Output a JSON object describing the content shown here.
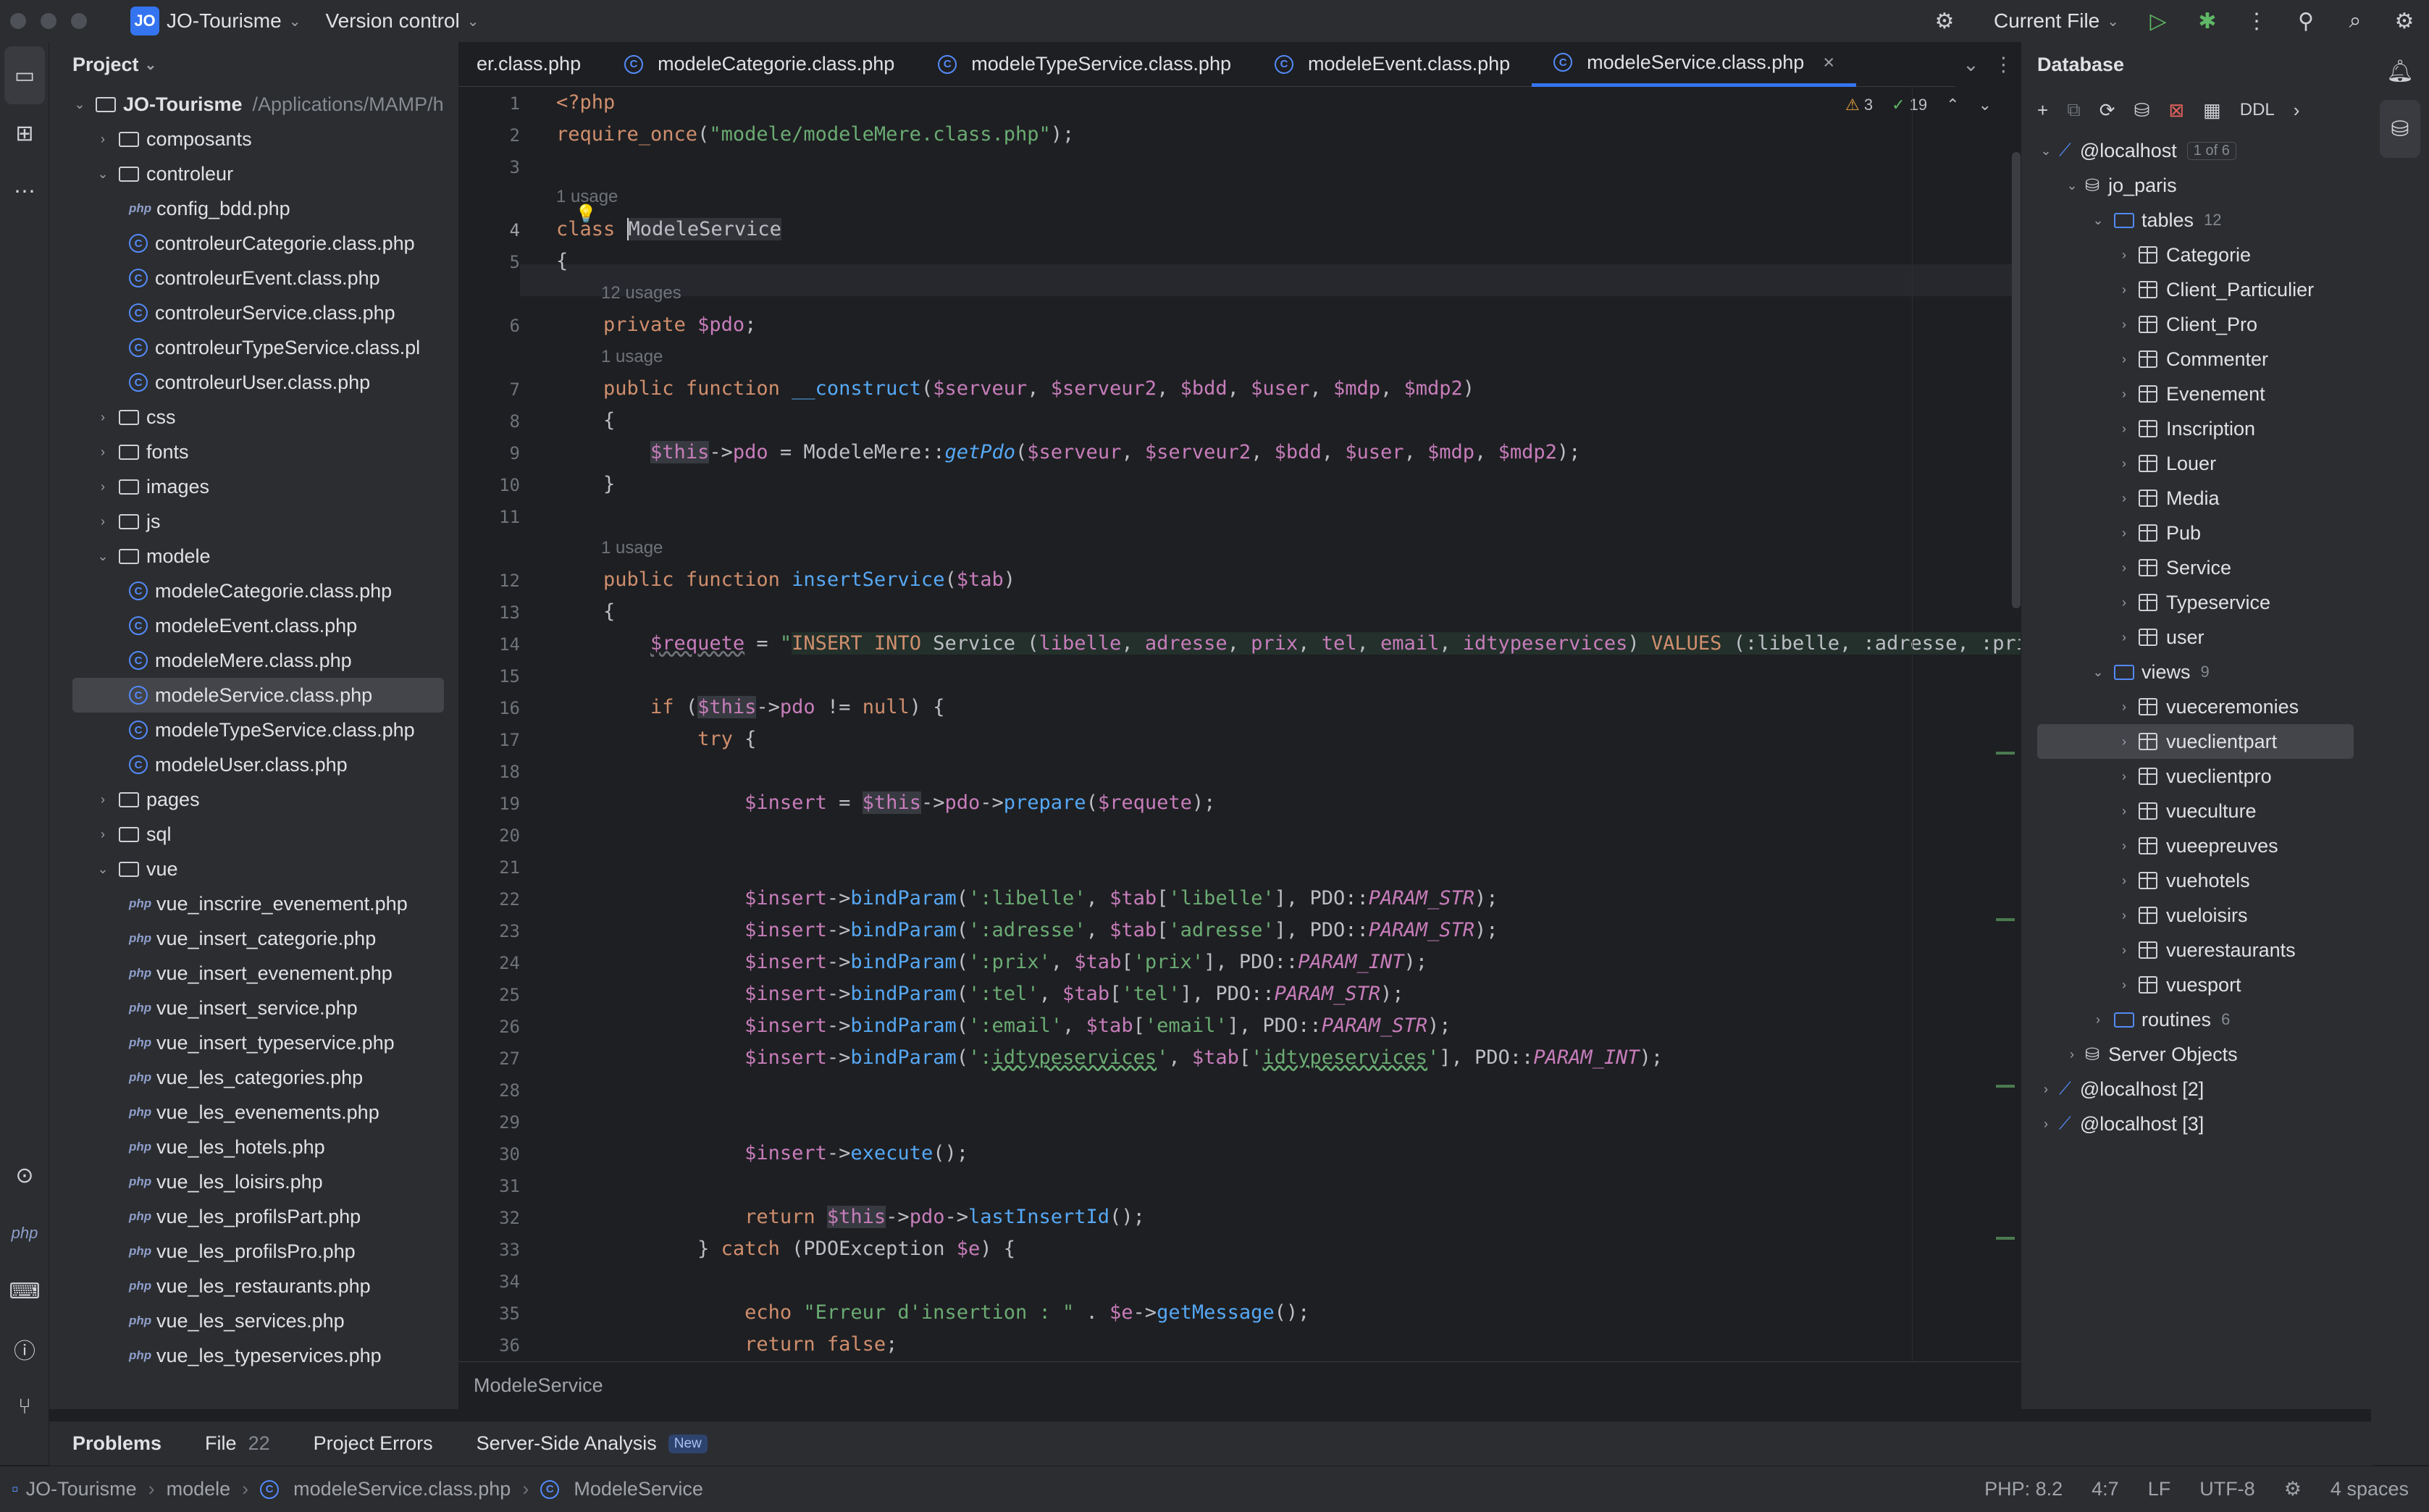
{
  "titlebar": {
    "project_badge": "JO",
    "project_name": "JO-Tourisme",
    "vcs": "Version control",
    "run_config": "Current File"
  },
  "project_panel": {
    "title": "Project",
    "root": {
      "name": "JO-Tourisme",
      "path": "/Applications/MAMP/h"
    },
    "rows": [
      {
        "type": "folder",
        "name": "composants",
        "level": 1,
        "expanded": false
      },
      {
        "type": "folder",
        "name": "controleur",
        "level": 1,
        "expanded": true
      },
      {
        "type": "php",
        "name": "config_bdd.php",
        "level": 2
      },
      {
        "type": "class",
        "name": "controleurCategorie.class.php",
        "level": 2
      },
      {
        "type": "class",
        "name": "controleurEvent.class.php",
        "level": 2
      },
      {
        "type": "class",
        "name": "controleurService.class.php",
        "level": 2
      },
      {
        "type": "class",
        "name": "controleurTypeService.class.pl",
        "level": 2
      },
      {
        "type": "class",
        "name": "controleurUser.class.php",
        "level": 2
      },
      {
        "type": "folder",
        "name": "css",
        "level": 1,
        "expanded": false
      },
      {
        "type": "folder",
        "name": "fonts",
        "level": 1,
        "expanded": false
      },
      {
        "type": "folder",
        "name": "images",
        "level": 1,
        "expanded": false
      },
      {
        "type": "folder",
        "name": "js",
        "level": 1,
        "expanded": false
      },
      {
        "type": "folder",
        "name": "modele",
        "level": 1,
        "expanded": true
      },
      {
        "type": "class",
        "name": "modeleCategorie.class.php",
        "level": 2
      },
      {
        "type": "class",
        "name": "modeleEvent.class.php",
        "level": 2
      },
      {
        "type": "class",
        "name": "modeleMere.class.php",
        "level": 2
      },
      {
        "type": "class",
        "name": "modeleService.class.php",
        "level": 2,
        "selected": true
      },
      {
        "type": "class",
        "name": "modeleTypeService.class.php",
        "level": 2
      },
      {
        "type": "class",
        "name": "modeleUser.class.php",
        "level": 2
      },
      {
        "type": "folder",
        "name": "pages",
        "level": 1,
        "expanded": false
      },
      {
        "type": "folder",
        "name": "sql",
        "level": 1,
        "expanded": false
      },
      {
        "type": "folder",
        "name": "vue",
        "level": 1,
        "expanded": true
      },
      {
        "type": "php",
        "name": "vue_inscrire_evenement.php",
        "level": 2
      },
      {
        "type": "php",
        "name": "vue_insert_categorie.php",
        "level": 2
      },
      {
        "type": "php",
        "name": "vue_insert_evenement.php",
        "level": 2
      },
      {
        "type": "php",
        "name": "vue_insert_service.php",
        "level": 2
      },
      {
        "type": "php",
        "name": "vue_insert_typeservice.php",
        "level": 2
      },
      {
        "type": "php",
        "name": "vue_les_categories.php",
        "level": 2
      },
      {
        "type": "php",
        "name": "vue_les_evenements.php",
        "level": 2
      },
      {
        "type": "php",
        "name": "vue_les_hotels.php",
        "level": 2
      },
      {
        "type": "php",
        "name": "vue_les_loisirs.php",
        "level": 2
      },
      {
        "type": "php",
        "name": "vue_les_profilsPart.php",
        "level": 2
      },
      {
        "type": "php",
        "name": "vue_les_profilsPro.php",
        "level": 2
      },
      {
        "type": "php",
        "name": "vue_les_restaurants.php",
        "level": 2
      },
      {
        "type": "php",
        "name": "vue_les_services.php",
        "level": 2
      },
      {
        "type": "php",
        "name": "vue_les_typeservices.php",
        "level": 2
      }
    ]
  },
  "editor": {
    "tabs": [
      {
        "label": "er.class.php",
        "active": false
      },
      {
        "label": "modeleCategorie.class.php",
        "active": false
      },
      {
        "label": "modeleTypeService.class.php",
        "active": false
      },
      {
        "label": "modeleEvent.class.php",
        "active": false
      },
      {
        "label": "modeleService.class.php",
        "active": true
      }
    ],
    "inspections": {
      "warnings": "3",
      "ok": "19"
    },
    "current_line": 4,
    "usage_hints": {
      "h1": "1 usage",
      "h2": "12 usages",
      "h3": "1 usage",
      "h4": "1 usage"
    },
    "breadcrumb": "ModeleService"
  },
  "database": {
    "title": "Database",
    "ddl_label": "DDL",
    "host": "@localhost",
    "host_count": "1 of 6",
    "schema": "jo_paris",
    "tables_label": "tables",
    "tables_count": "12",
    "tables": [
      "Categorie",
      "Client_Particulier",
      "Client_Pro",
      "Commenter",
      "Evenement",
      "Inscription",
      "Louer",
      "Media",
      "Pub",
      "Service",
      "Typeservice",
      "user"
    ],
    "views_label": "views",
    "views_count": "9",
    "views": [
      "vueceremonies",
      "vueclientpart",
      "vueclientpro",
      "vueculture",
      "vueepreuves",
      "vuehotels",
      "vueloisirs",
      "vuerestaurants",
      "vuesport"
    ],
    "selected_view": "vueclientpart",
    "routines_label": "routines",
    "routines_count": "6",
    "server_objects": "Server Objects",
    "other_hosts": [
      "@localhost [2]",
      "@localhost [3]"
    ]
  },
  "problems_bar": {
    "tabs": [
      {
        "label": "Problems",
        "active": true
      },
      {
        "label": "File",
        "count": "22"
      },
      {
        "label": "Project Errors"
      },
      {
        "label": "Server-Side Analysis",
        "badge": "New"
      }
    ]
  },
  "statusbar": {
    "crumbs": [
      "JO-Tourisme",
      "modele",
      "modeleService.class.php",
      "ModeleService"
    ],
    "php_version": "PHP: 8.2",
    "position": "4:7",
    "line_ending": "LF",
    "encoding": "UTF-8",
    "indent": "4 spaces"
  },
  "colors": {
    "accent": "#3574f0",
    "background": "#1e1f22",
    "panel": "#2b2d30"
  }
}
